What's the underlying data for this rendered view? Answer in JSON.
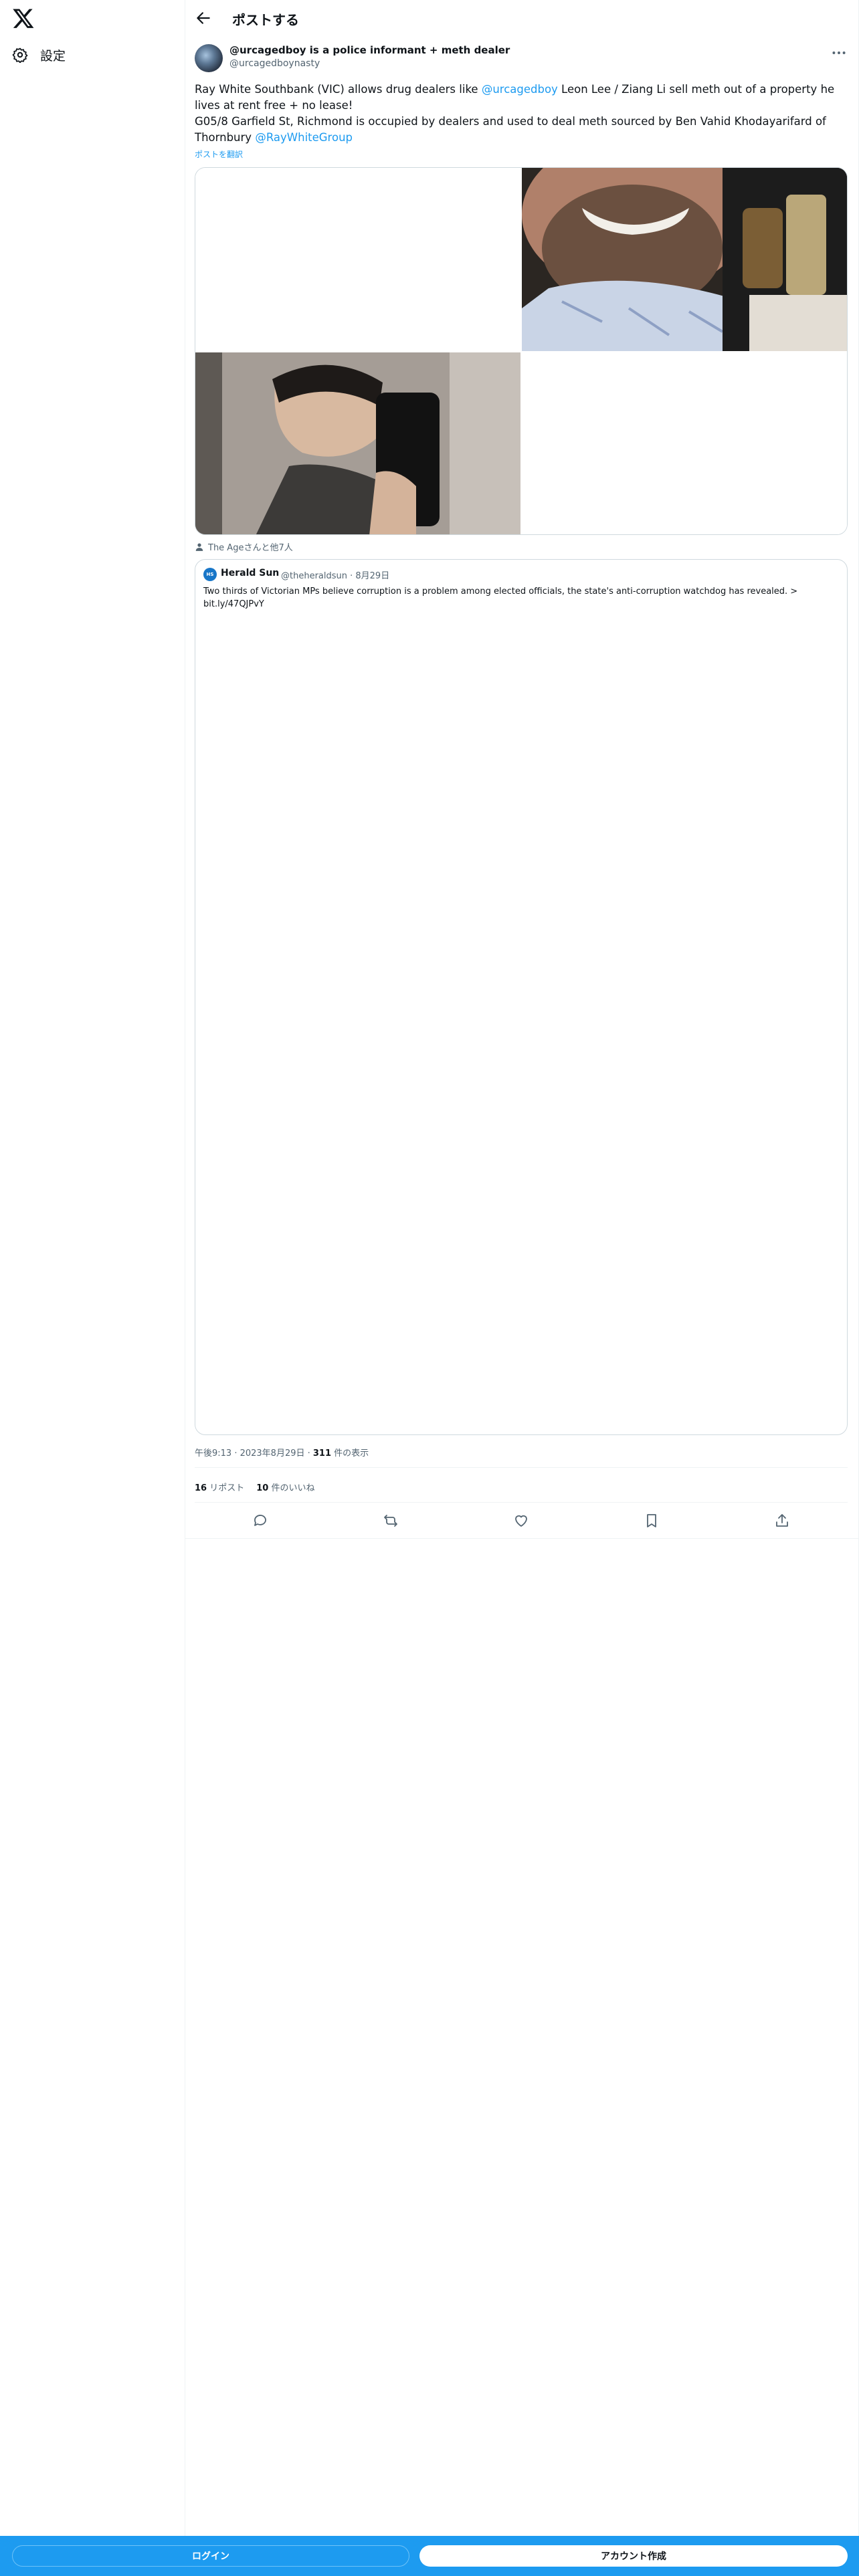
{
  "nav": {
    "settings_label": "設定"
  },
  "header": {
    "title": "ポストする"
  },
  "post": {
    "author_name": "@urcagedboy is a police informant + meth dealer",
    "author_handle": "@urcagedboynasty",
    "text_part1": "Ray White Southbank (VIC) allows drug dealers like ",
    "mention1": "@urcagedboy",
    "text_part2": " Leon Lee / Ziang Li sell meth out of a property he lives at rent free + no lease!",
    "text_line2": "G05/8 Garfield St, Richmond is occupied by dealers and used to deal meth sourced by Ben Vahid Khodayarifard of Thornbury ",
    "mention2": "@RayWhiteGroup",
    "translate_label": "ポストを翻訳",
    "tagged": "The Ageさんと他7人",
    "timestamp": "午後9:13 · 2023年8月29日 · ",
    "views_count": "311",
    "views_label": " 件の表示",
    "reposts_count": "16",
    "reposts_label": " リポスト",
    "likes_count": "10",
    "likes_label": " 件のいいね"
  },
  "quote": {
    "avatar_text": "HS",
    "name": "Herald Sun",
    "handle": "@theheraldsun · 8月29日",
    "text": "Two thirds of Victorian MPs believe corruption is a problem among elected officials, the state's anti-corruption watchdog has revealed. > bit.ly/47QJPvY"
  },
  "bottombar": {
    "login_label": "ログイン",
    "signup_label": "アカウント作成"
  },
  "colors": {
    "accent": "#1d9bf0",
    "text": "#0f1419",
    "muted": "#536471",
    "border": "#cfd9de"
  }
}
